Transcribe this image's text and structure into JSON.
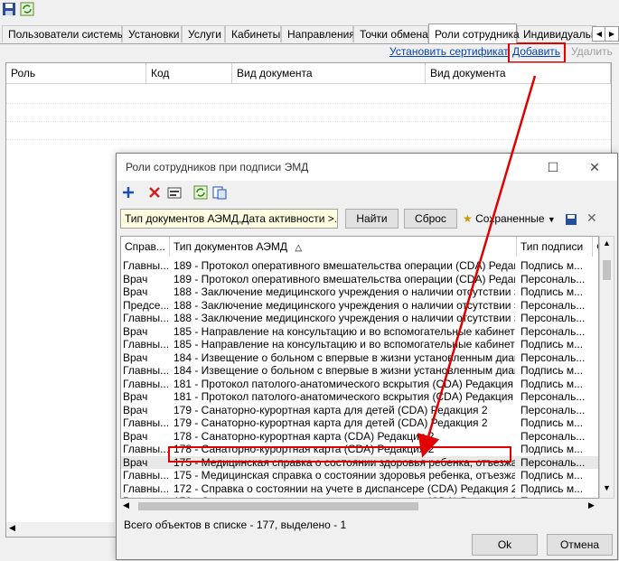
{
  "tabs": [
    {
      "label": "Пользователи системы"
    },
    {
      "label": "Установки"
    },
    {
      "label": "Услуги"
    },
    {
      "label": "Кабинеты"
    },
    {
      "label": "Направления"
    },
    {
      "label": "Точки обмена"
    },
    {
      "label": "Роли сотрудника"
    },
    {
      "label": "Индивидуальны"
    }
  ],
  "actions": {
    "install_cert": "Установить сертификат",
    "add": "Добавить",
    "delete": "Удалить"
  },
  "main_grid": {
    "columns": [
      "Роль",
      "Код",
      "Вид документа",
      "Вид документа"
    ]
  },
  "dialog": {
    "title": "Роли сотрудников при подписи ЭМД",
    "filter_text": "Тип документов АЭМД,Дата активности >...",
    "find_btn": "Найти",
    "reset_btn": "Сброс",
    "saved_label": "Сохраненные",
    "columns": [
      "Справ...",
      "Тип документов АЭМД",
      "Тип подписи",
      "Ф"
    ],
    "rows": [
      [
        "Главны...",
        "189 - Протокол оперативного вмешательства операции (CDA) Редакция 3",
        "Подпись м..."
      ],
      [
        "Врач",
        "189 - Протокол оперативного вмешательства операции (CDA) Редакция 3",
        "Персональ..."
      ],
      [
        "Врач",
        "188 - Заключение медицинского учреждения о наличии отсутствии заб...",
        "Подпись м..."
      ],
      [
        "Предсе...",
        "188 - Заключение медицинского учреждения о наличии отсутствии заб...",
        "Персональ..."
      ],
      [
        "Главны...",
        "188 - Заключение медицинского учреждения о наличии отсутствии заб...",
        "Персональ..."
      ],
      [
        "Врач",
        "185 - Направление на консультацию и во вспомогательные кабинеты (...",
        "Персональ..."
      ],
      [
        "Главны...",
        "185 - Направление на консультацию и во вспомогательные кабинеты (...",
        "Подпись м..."
      ],
      [
        "Врач",
        "184 - Извещение о больном с впервые в жизни установленным диагн...",
        "Персональ..."
      ],
      [
        "Главны...",
        "184 - Извещение о больном с впервые в жизни установленным диагн...",
        "Подпись м..."
      ],
      [
        "Главны...",
        "181 - Протокол патолого-анатомического вскрытия (CDA) Редакция 1",
        "Подпись м..."
      ],
      [
        "Врач",
        "181 - Протокол патолого-анатомического вскрытия (CDA) Редакция 1",
        "Персональ..."
      ],
      [
        "Врач",
        "179 - Санаторно-курортная карта для детей (CDA) Редакция 2",
        "Персональ..."
      ],
      [
        "Главны...",
        "179 - Санаторно-курортная карта для детей (CDA) Редакция 2",
        "Подпись м..."
      ],
      [
        "Врач",
        "178 - Санаторно-курортная карта (CDA) Редакция 2",
        "Персональ..."
      ],
      [
        "Главны...",
        "178 - Санаторно-курортная карта (CDA) Редакция 2",
        "Подпись м..."
      ],
      [
        "Врач",
        "175 - Медицинская справка о состоянии здоровья ребенка, отъезжаю...",
        "Персональ..."
      ],
      [
        "Главны...",
        "175 - Медицинская справка о состоянии здоровья ребенка, отъезжаю...",
        "Подпись м..."
      ],
      [
        "Главны...",
        "172 - Справка о состоянии на учете в диспансере (CDA) Редакция 2",
        "Подпись м..."
      ],
      [
        "Врач",
        "172 - Справка о состоянии на учете в диспансере (CDA) Редакция 2",
        "Персональ..."
      ]
    ],
    "selected_row": 15,
    "status": "Всего объектов в списке - 177, выделено - 1",
    "ok": "Ok",
    "cancel": "Отмена"
  },
  "colors": {
    "annotation": "#e00000",
    "link": "#0645ad"
  }
}
